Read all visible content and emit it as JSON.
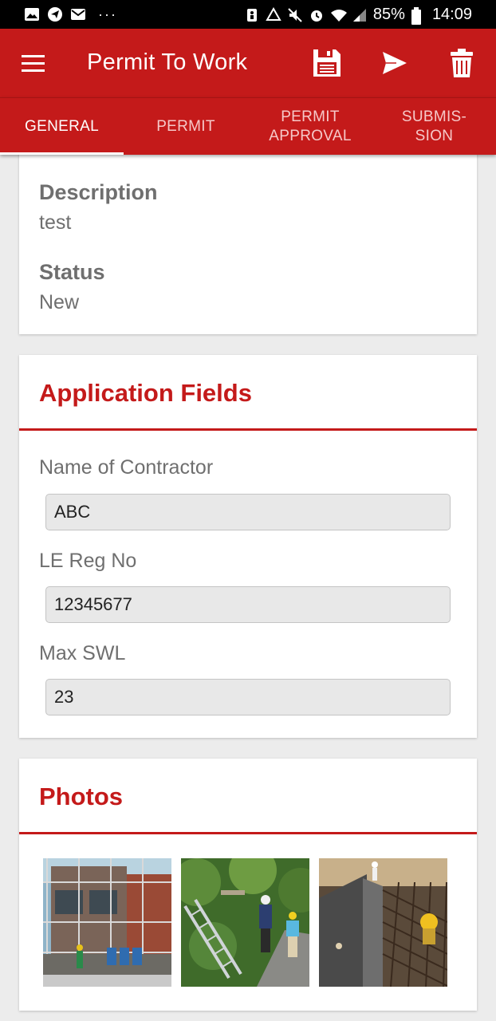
{
  "status_bar": {
    "left_icons": [
      "gallery-icon",
      "telegram-icon",
      "mail-icon"
    ],
    "dots": "···",
    "right_icons": [
      "accessibility-icon",
      "recycle-icon",
      "mute-icon",
      "alarm-icon",
      "wifi-icon",
      "signal-icon"
    ],
    "battery": "85%",
    "time": "14:09"
  },
  "app_bar": {
    "title": "Permit To Work",
    "actions": [
      "save-icon",
      "send-icon",
      "trash-icon"
    ]
  },
  "tabs": [
    {
      "label": "GENERAL",
      "active": true
    },
    {
      "label": "PERMIT",
      "active": false
    },
    {
      "label": "PERMIT\nAPPROVAL",
      "active": false
    },
    {
      "label": "SUBMIS-\nSION",
      "active": false
    }
  ],
  "general": {
    "description_label": "Description",
    "description_value": "test",
    "status_label": "Status",
    "status_value": "New"
  },
  "application_fields": {
    "title": "Application Fields",
    "fields": [
      {
        "label": "Name of Contractor",
        "value": "ABC"
      },
      {
        "label": "LE Reg No",
        "value": "12345677"
      },
      {
        "label": "Max SWL",
        "value": "23"
      }
    ]
  },
  "photos": {
    "title": "Photos",
    "items": [
      "scaffolding-photo",
      "ladder-work-photo",
      "rebar-site-photo"
    ]
  },
  "colors": {
    "primary": "#c41a1a",
    "label_gray": "#6f6f6f",
    "input_bg": "#e8e8e8"
  }
}
